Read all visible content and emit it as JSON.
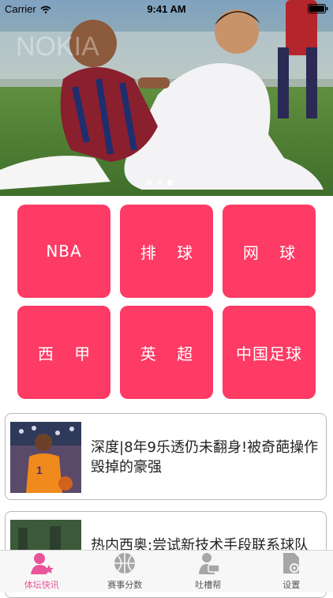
{
  "status_bar": {
    "carrier": "Carrier",
    "time": "9:41 AM"
  },
  "banner": {
    "page_count": 3,
    "active_page": 3
  },
  "categories": [
    {
      "label": "NBA"
    },
    {
      "label": "排 球"
    },
    {
      "label": "网 球"
    },
    {
      "label": "西 甲"
    },
    {
      "label": "英 超"
    },
    {
      "label": "中国足球"
    }
  ],
  "news": [
    {
      "title": "深度|8年9乐透仍未翻身!被奇葩操作毁掉的豪强"
    },
    {
      "title": "热内西奥:尝试新技术手段联系球队"
    }
  ],
  "tabs": [
    {
      "label": "体坛快讯",
      "icon": "user-star-icon",
      "active": true
    },
    {
      "label": "赛事分数",
      "icon": "ball-icon",
      "active": false
    },
    {
      "label": "吐槽帮",
      "icon": "chat-person-icon",
      "active": false
    },
    {
      "label": "设置",
      "icon": "settings-doc-icon",
      "active": false
    }
  ],
  "colors": {
    "tile": "#fd3b65",
    "tab_active": "#e8549a",
    "tab_inactive": "#9a9a9a"
  }
}
